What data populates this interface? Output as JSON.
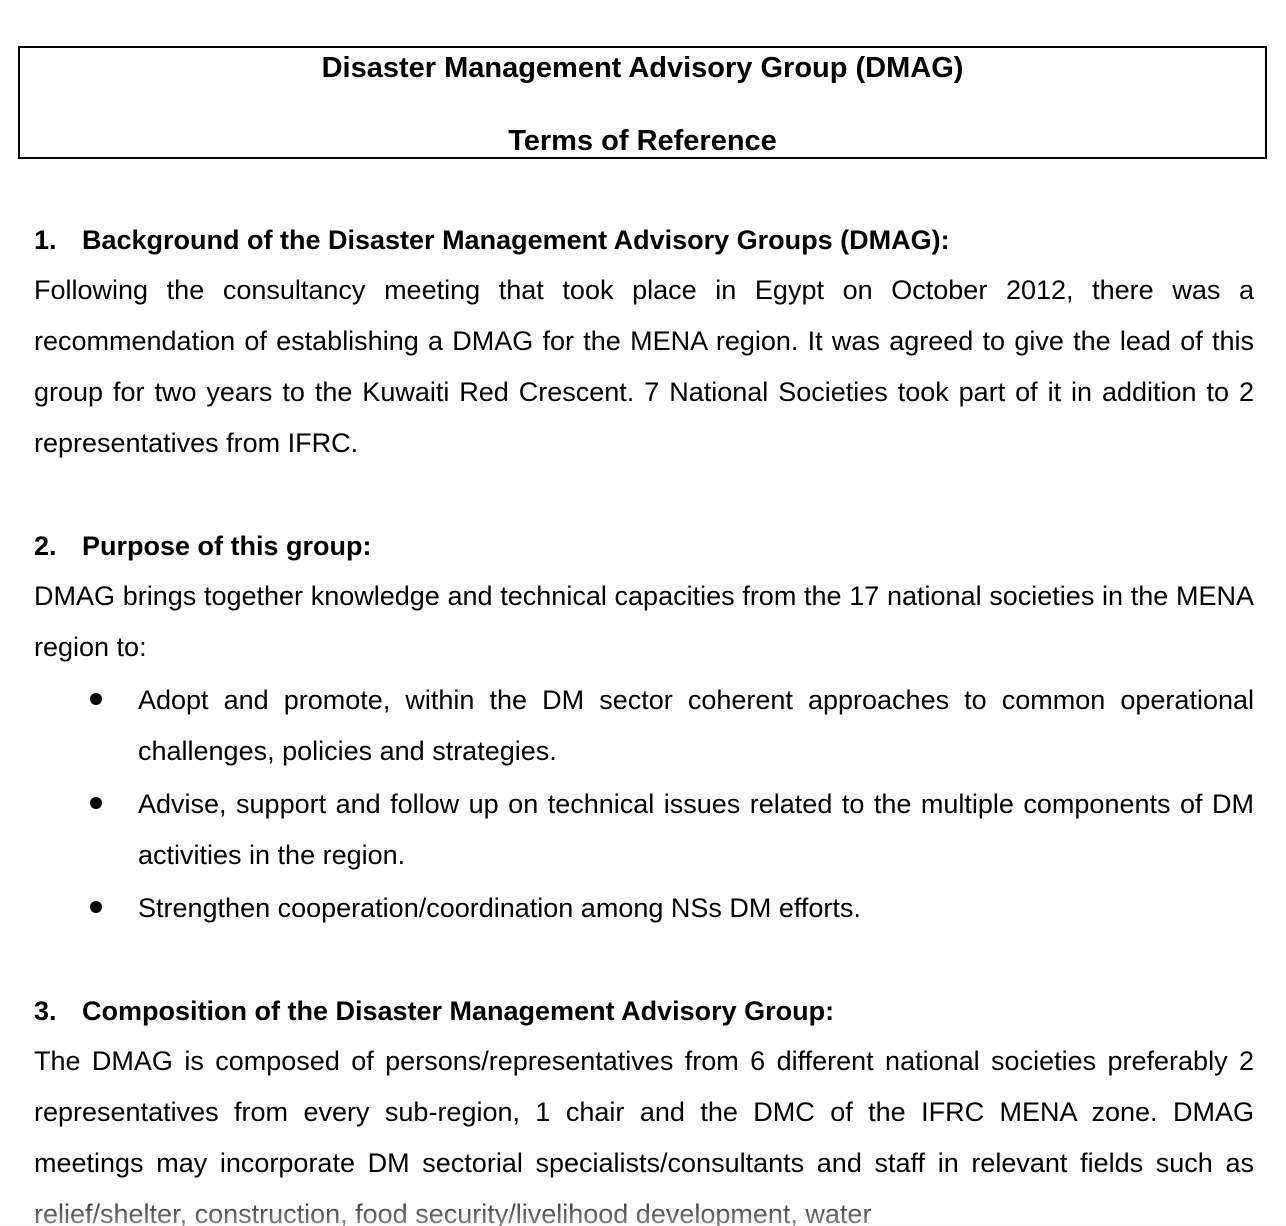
{
  "document": {
    "title": "Disaster Management Advisory Group (DMAG)",
    "subtitle": "Terms of Reference"
  },
  "sections": [
    {
      "number": "1.",
      "heading": "Background of the Disaster Management Advisory Groups (DMAG):",
      "text": "Following the consultancy meeting that took place in Egypt on October 2012, there was a recommendation of establishing a DMAG for the MENA region. It was agreed to give the lead of this group for two years to the Kuwaiti Red Crescent. 7 National Societies took part of it in addition to 2 representatives from IFRC."
    },
    {
      "number": "2.",
      "heading": "Purpose of this group:",
      "text": "DMAG brings together knowledge and technical capacities from the 17 national societies in the MENA region to:",
      "bullets": [
        "Adopt and promote, within the DM sector coherent approaches to common operational challenges, policies and strategies.",
        "Advise, support and follow up on technical issues related to the multiple components of DM activities in the region.",
        "Strengthen cooperation/coordination among NSs DM efforts."
      ]
    },
    {
      "number": "3.",
      "heading": "Composition of the Disaster Management Advisory Group:",
      "text": "The DMAG is composed of persons/representatives from 6 different national societies preferably 2 representatives from every sub-region, 1 chair and the DMC of the IFRC MENA zone. DMAG meetings may incorporate DM sectorial specialists/consultants and staff in relevant fields such as relief/shelter, construction, food security/livelihood development, water"
    }
  ]
}
